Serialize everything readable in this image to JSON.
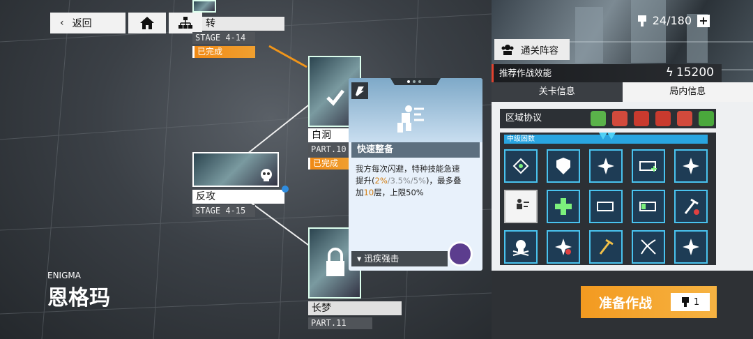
{
  "nav": {
    "back_label": "返回"
  },
  "map": {
    "enigma_en": "ENIGMA",
    "enigma_cn": "恩格玛",
    "nodes": [
      {
        "name": "转",
        "stage": "STAGE 4-14",
        "status": "已完成"
      },
      {
        "name": "白洞",
        "stage": "PART.10",
        "status": "已完成"
      },
      {
        "name": "反攻",
        "stage": "STAGE 4-15"
      },
      {
        "name": "长梦",
        "stage": "PART.11"
      }
    ]
  },
  "card": {
    "title": "快速整备",
    "desc_line1": "我方每次闪避，特种技能急速",
    "desc_line2_prefix": "提升(",
    "desc_v1": "2%",
    "desc_v2": "/3.5%/5%",
    "desc_line2_suffix": ")，最多叠",
    "desc_line3_prefix": "加",
    "desc_v3": "10",
    "desc_line3_suffix": "层，上限50%",
    "footer": "迅疾强击"
  },
  "panel": {
    "stamina": "24/180",
    "lineup_label": "通关阵容",
    "power_label": "推荐作战效能",
    "power_value": "15200",
    "tabs": [
      "关卡信息",
      "局内信息"
    ],
    "zone_label": "区域协议",
    "difficulty_label": "中级困数",
    "deploy_label": "准备作战",
    "deploy_cost": "1"
  }
}
